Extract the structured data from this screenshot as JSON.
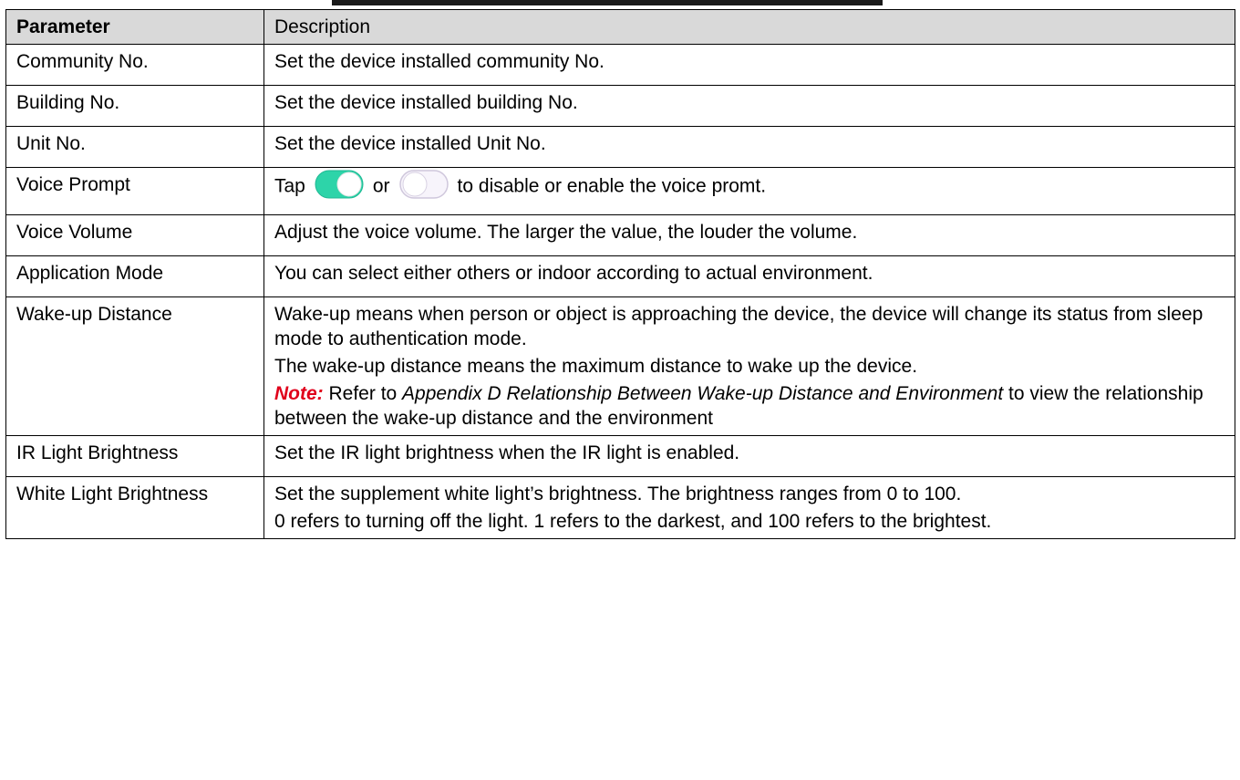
{
  "header": {
    "parameter": "Parameter",
    "description": "Description"
  },
  "rows": [
    {
      "param": "Community No.",
      "desc": "Set the device installed community No."
    },
    {
      "param": "Building No.",
      "desc": "Set the device installed building No."
    },
    {
      "param": "Unit No.",
      "desc": "Set the device installed Unit No."
    },
    {
      "param": "Voice Prompt",
      "desc_before": "Tap",
      "desc_middle": "or",
      "desc_after": "to disable or enable the voice promt."
    },
    {
      "param": "Voice Volume",
      "desc": "Adjust the voice volume. The larger the value, the louder the volume."
    },
    {
      "param": "Application Mode",
      "desc": "You can select either others or indoor according to actual environment."
    },
    {
      "param": "Wake-up Distance",
      "p1": "Wake-up means when person or object is approaching the device, the device will change its status from sleep mode to authentication mode.",
      "p2": "The wake-up distance means the maximum distance to wake up the device.",
      "note_label": "Note:",
      "note_pre": " Refer to ",
      "note_ref": "Appendix D Relationship Between Wake-up Distance and Environment",
      "note_post": " to view the relationship between the wake-up distance and the environment"
    },
    {
      "param": "IR Light Brightness",
      "desc": "Set the IR light brightness when the IR light is enabled."
    },
    {
      "param": "White Light Brightness",
      "p1": "Set the supplement white light’s brightness. The brightness ranges from 0 to 100.",
      "p2": "0 refers to turning off the light. 1 refers to the darkest, and 100 refers to the brightest."
    }
  ],
  "icons": {
    "toggle_on": "toggle-on-icon",
    "toggle_off": "toggle-off-icon"
  },
  "colors": {
    "header_bg": "#d9d9d9",
    "note": "#e0001b",
    "toggle_on": "#2dd4a9"
  }
}
